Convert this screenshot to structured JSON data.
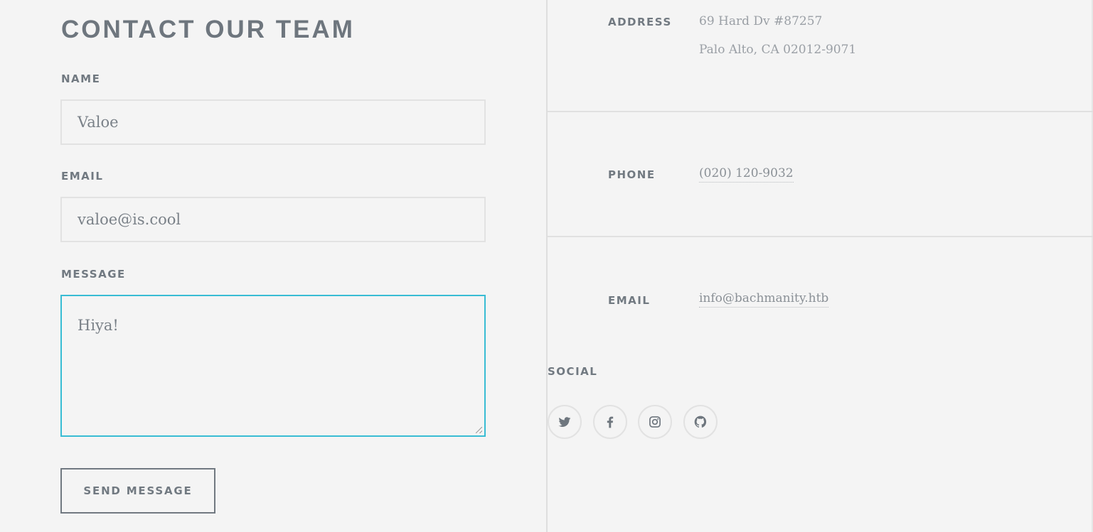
{
  "form": {
    "heading": "CONTACT OUR TEAM",
    "name_label": "NAME",
    "name_value": "Valoe",
    "email_label": "EMAIL",
    "email_value": "valoe@is.cool",
    "message_label": "MESSAGE",
    "message_value": "Hiya!",
    "send_label": "SEND MESSAGE"
  },
  "info": {
    "address_label": "ADDRESS",
    "address_line1": "69 Hard Dv #87257",
    "address_line2": "Palo Alto, CA 02012-9071",
    "phone_label": "PHONE",
    "phone_value": "(020) 120-9032",
    "email_label": "EMAIL",
    "email_value": "info@bachmanity.htb"
  },
  "social": {
    "label": "SOCIAL",
    "icons": [
      "twitter-icon",
      "facebook-icon",
      "instagram-icon",
      "github-icon"
    ]
  },
  "colors": {
    "background": "#f4f4f4",
    "text": "#717981",
    "focus_border": "#38bcd4"
  }
}
